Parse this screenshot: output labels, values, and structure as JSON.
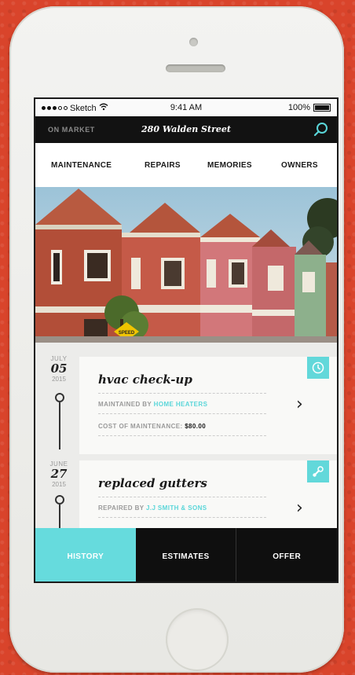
{
  "status_bar": {
    "carrier": "Sketch",
    "time": "9:41 AM",
    "battery": "100%"
  },
  "header": {
    "status": "ON MARKET",
    "address": "280 Walden Street"
  },
  "tabs": [
    {
      "label": "MAINTENANCE"
    },
    {
      "label": "REPAIRS"
    },
    {
      "label": "MEMORIES"
    },
    {
      "label": "OWNERS"
    }
  ],
  "hero": {
    "sign_text": "SPEED"
  },
  "timeline": [
    {
      "month": "JULY",
      "day": "05",
      "year": "2015",
      "title": "hvac check-up",
      "meta1_label": "MAINTAINED BY",
      "meta1_value": "HOME HEATERS",
      "meta2_label": "COST OF MAINTENANCE:",
      "meta2_value": "$80.00",
      "icon": "clock-icon"
    },
    {
      "month": "JUNE",
      "day": "27",
      "year": "2015",
      "title": "replaced gutters",
      "meta1_label": "REPAIRED BY",
      "meta1_value": "J.J SMITH & SONS",
      "icon": "wrench-icon"
    }
  ],
  "bottom_nav": [
    {
      "label": "HISTORY",
      "active": true
    },
    {
      "label": "ESTIMATES",
      "active": false
    },
    {
      "label": "OFFER",
      "active": false
    }
  ],
  "colors": {
    "accent": "#62d8da",
    "background": "#d9442b",
    "header": "#121212"
  }
}
